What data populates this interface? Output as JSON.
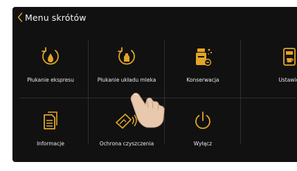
{
  "header": {
    "back_icon": "chevron-left-icon",
    "title": "Menu skrótów"
  },
  "tiles": [
    {
      "label": "Płukanie ekspresu",
      "icon": "rinse-machine-icon"
    },
    {
      "label": "Płukanie układu mleka",
      "icon": "rinse-milk-system-icon"
    },
    {
      "label": "Konserwacja",
      "icon": "maintenance-icon"
    },
    {
      "label": "Ustawienia",
      "icon": "machine-settings-icon"
    },
    {
      "label": "Informacje",
      "icon": "information-document-icon"
    },
    {
      "label": "Ochrona czyszczenia",
      "icon": "cleaning-protection-icon"
    },
    {
      "label": "Wyłącz",
      "icon": "power-icon"
    }
  ],
  "colors": {
    "accent": "#e3a526",
    "background": "#111112",
    "text": "#eaeaea",
    "divider": "#2e2e30"
  }
}
